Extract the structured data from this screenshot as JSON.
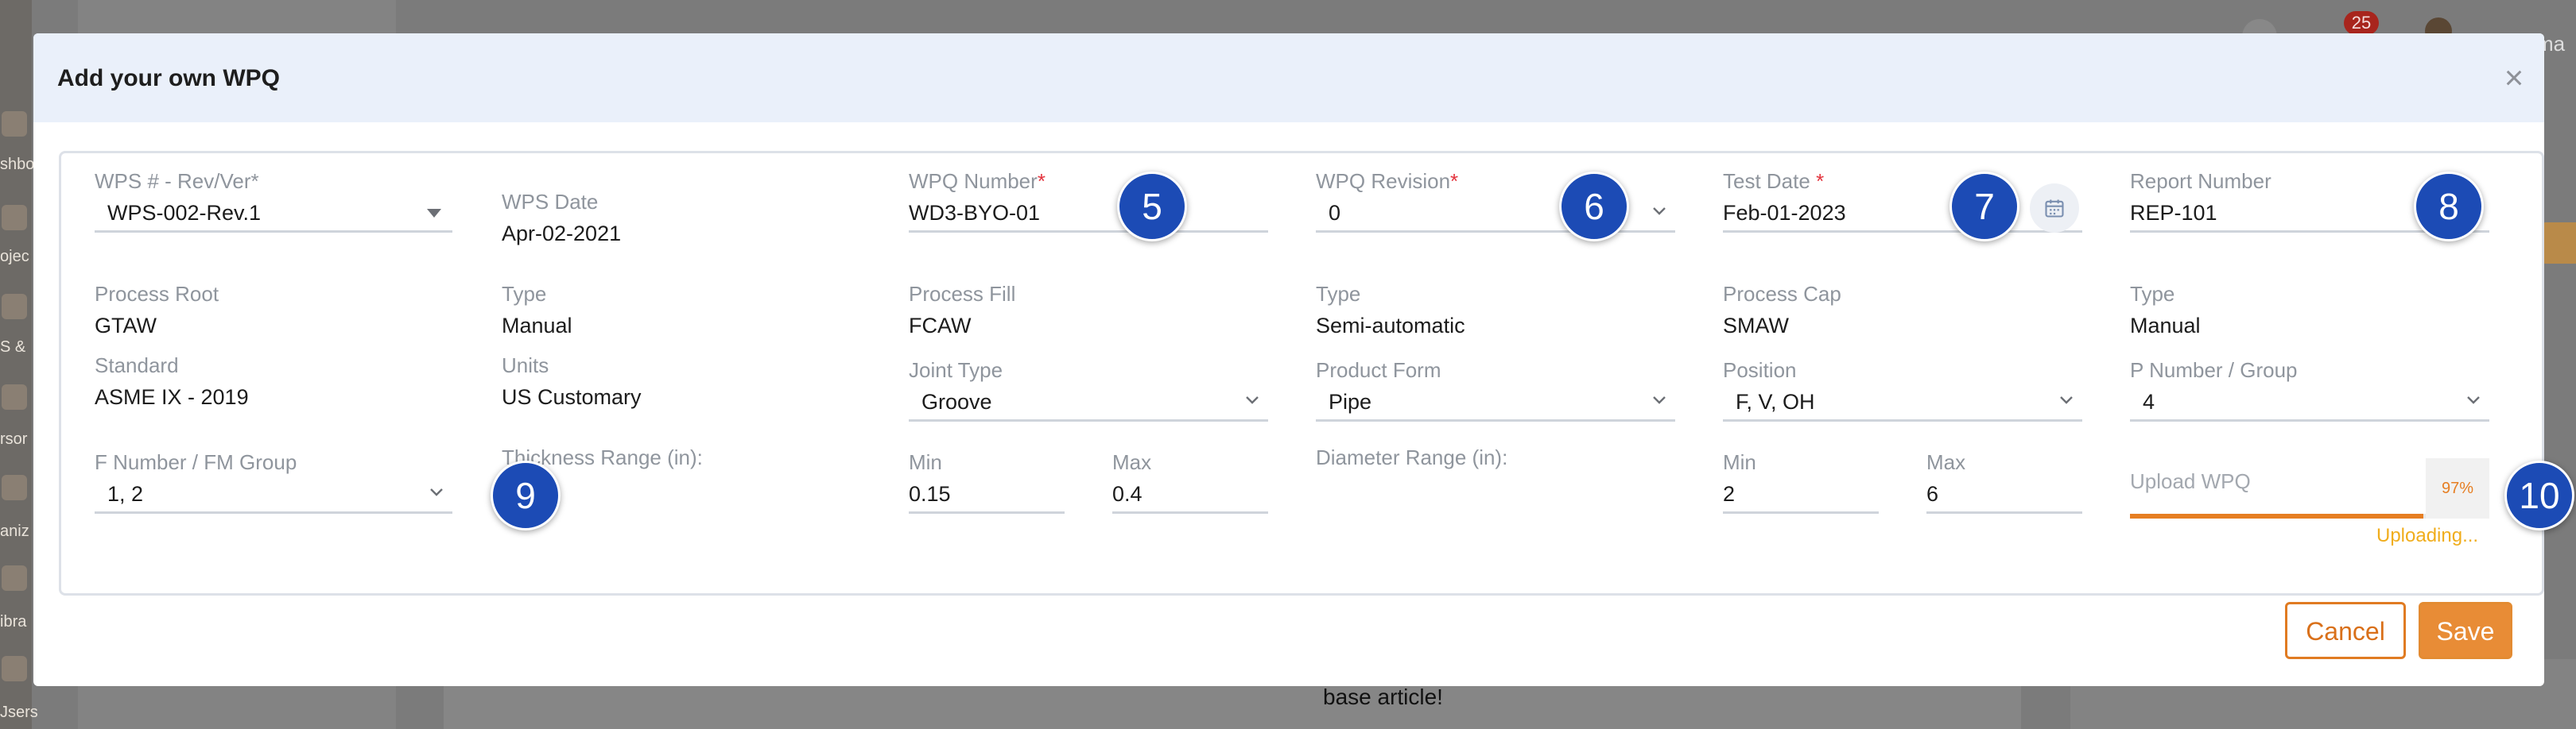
{
  "background": {
    "sidebar_labels": [
      "shbo",
      "ojec",
      "S &",
      "rsor",
      "aniz",
      "ibra",
      "Jsers"
    ],
    "notification_count": "25",
    "user_fragment": "ma",
    "article_text": "base article!"
  },
  "modal": {
    "title": "Add your own WPQ",
    "close_icon": "×",
    "fields": {
      "wps": {
        "label": "WPS # - Rev/Ver*",
        "value": "WPS-002-Rev.1"
      },
      "wps_date": {
        "label": "WPS Date",
        "value": "Apr-02-2021"
      },
      "wpq_number": {
        "label": "WPQ Number",
        "required": "*",
        "value": "WD3-BYO-01"
      },
      "wpq_revision": {
        "label": "WPQ Revision",
        "required": "*",
        "value": "0"
      },
      "test_date": {
        "label": "Test Date ",
        "required": "*",
        "value": "Feb-01-2023"
      },
      "report_number": {
        "label": "Report Number",
        "value": "REP-101"
      },
      "process_root": {
        "label": "Process Root",
        "value": "GTAW"
      },
      "type_root": {
        "label": "Type",
        "value": "Manual"
      },
      "process_fill": {
        "label": "Process Fill",
        "value": "FCAW"
      },
      "type_fill": {
        "label": "Type",
        "value": "Semi-automatic"
      },
      "process_cap": {
        "label": "Process Cap",
        "value": "SMAW"
      },
      "type_cap": {
        "label": "Type",
        "value": "Manual"
      },
      "standard": {
        "label": "Standard",
        "value": "ASME IX - 2019"
      },
      "units": {
        "label": "Units",
        "value": "US Customary"
      },
      "joint_type": {
        "label": "Joint Type",
        "value": "Groove"
      },
      "product_form": {
        "label": "Product Form",
        "value": "Pipe"
      },
      "position": {
        "label": "Position",
        "value": "F, V, OH"
      },
      "p_number": {
        "label": "P Number / Group",
        "value": "4"
      },
      "f_number": {
        "label": "F Number / FM Group",
        "value": "1, 2"
      },
      "thickness_range": {
        "label": "Thickness Range (in):"
      },
      "thickness_min": {
        "label": "Min",
        "value": "0.15"
      },
      "thickness_max": {
        "label": "Max",
        "value": "0.4"
      },
      "diameter_range": {
        "label": "Diameter Range (in):"
      },
      "diameter_min": {
        "label": "Min",
        "value": "2"
      },
      "diameter_max": {
        "label": "Max",
        "value": "6"
      }
    },
    "upload": {
      "label": "Upload WPQ",
      "percent_text": "97%",
      "progress": 0.97,
      "status": "Uploading..."
    },
    "markers": [
      "5",
      "6",
      "7",
      "8",
      "9",
      "10"
    ],
    "buttons": {
      "cancel": "Cancel",
      "save": "Save"
    }
  },
  "colors": {
    "accent_orange": "#e88c36",
    "marker_blue": "#1c4bb5",
    "required_red": "#e3333d",
    "header_bg": "#eaf0fa"
  }
}
